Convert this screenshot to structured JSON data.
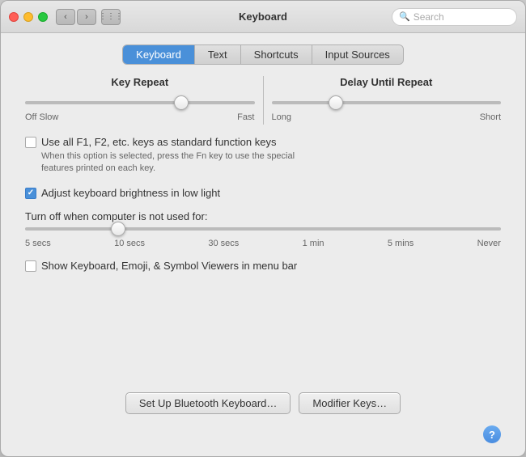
{
  "titlebar": {
    "title": "Keyboard",
    "search_placeholder": "Search"
  },
  "tabs": [
    {
      "id": "keyboard",
      "label": "Keyboard",
      "active": true
    },
    {
      "id": "text",
      "label": "Text",
      "active": false
    },
    {
      "id": "shortcuts",
      "label": "Shortcuts",
      "active": false
    },
    {
      "id": "input-sources",
      "label": "Input Sources",
      "active": false
    }
  ],
  "key_repeat": {
    "label": "Key Repeat",
    "min_label": "Off  Slow",
    "max_label": "Fast"
  },
  "delay_until_repeat": {
    "label": "Delay Until Repeat",
    "min_label": "Long",
    "max_label": "Short"
  },
  "checkbox_fn": {
    "label": "Use all F1, F2, etc. keys as standard function keys",
    "sublabel": "When this option is selected, press the Fn key to use the special\nfeatures printed on each key."
  },
  "checkbox_brightness": {
    "label": "Adjust keyboard brightness in low light",
    "checked": true
  },
  "turnoff": {
    "label": "Turn off when computer is not used for:",
    "ticks": [
      "5 secs",
      "10 secs",
      "30 secs",
      "1 min",
      "5 mins",
      "Never"
    ]
  },
  "checkbox_viewers": {
    "label": "Show Keyboard, Emoji, & Symbol Viewers in menu bar",
    "checked": false
  },
  "buttons": {
    "bluetooth": "Set Up Bluetooth Keyboard…",
    "modifier": "Modifier Keys…"
  },
  "help": "?"
}
